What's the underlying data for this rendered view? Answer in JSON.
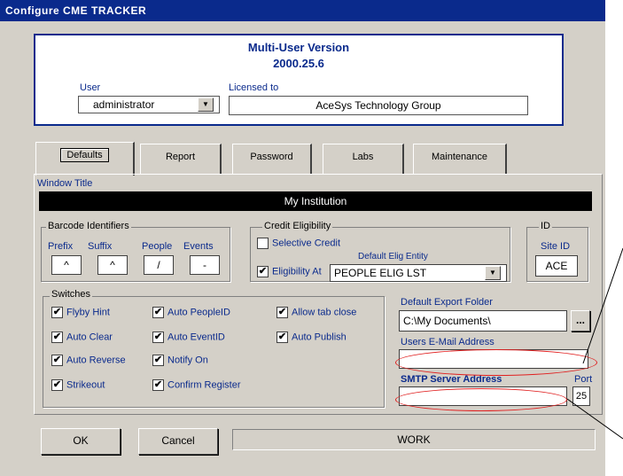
{
  "window": {
    "title": "Configure CME TRACKER"
  },
  "header": {
    "version": "Multi-User Version",
    "build": "2000.25.6",
    "user_label": "User",
    "user_value": "administrator",
    "licensed_label": "Licensed to",
    "licensed_value": "AceSys Technology Group"
  },
  "tabs": [
    "Defaults",
    "Report",
    "Password",
    "Labs",
    "Maintenance"
  ],
  "defaults": {
    "window_title_label": "Window Title",
    "window_title_value": "My Institution",
    "barcode": {
      "title": "Barcode Identifiers",
      "fields": [
        {
          "label": "Prefix",
          "value": "^"
        },
        {
          "label": "Suffix",
          "value": "^"
        },
        {
          "label": "People",
          "value": "/"
        },
        {
          "label": "Events",
          "value": "-"
        }
      ]
    },
    "credit": {
      "title": "Credit Eligibility",
      "selective_label": "Selective Credit",
      "selective_checked": false,
      "elig_label": "Eligibility At",
      "elig_checked": true,
      "default_elig_label": "Default Elig Entity",
      "default_elig_value": "PEOPLE ELIG LST"
    },
    "id": {
      "title": "ID",
      "site_label": "Site ID",
      "site_value": "ACE"
    },
    "switches": {
      "title": "Switches",
      "items": [
        {
          "label": "Flyby Hint",
          "checked": true
        },
        {
          "label": "Auto PeopleID",
          "checked": true
        },
        {
          "label": "Allow tab close",
          "checked": true
        },
        {
          "label": "Auto Clear",
          "checked": true
        },
        {
          "label": "Auto EventID",
          "checked": true
        },
        {
          "label": "Auto Publish",
          "checked": true
        },
        {
          "label": "Auto Reverse",
          "checked": true
        },
        {
          "label": "Notify On",
          "checked": true
        },
        {
          "label": "Strikeout",
          "checked": true
        },
        {
          "label": "Confirm Register",
          "checked": true
        }
      ]
    },
    "export_label": "Default Export Folder",
    "export_value": "C:\\My Documents\\",
    "browse_label": "...",
    "email_label": "Users E-Mail Address",
    "email_value": "",
    "smtp_label": "SMTP Server Address",
    "smtp_value": "",
    "port_label": "Port",
    "port_value": "25"
  },
  "footer": {
    "ok_label": "OK",
    "cancel_label": "Cancel",
    "status": "WORK"
  },
  "colors": {
    "title_bar": "#0a2a8c",
    "highlight": "#e02020"
  }
}
